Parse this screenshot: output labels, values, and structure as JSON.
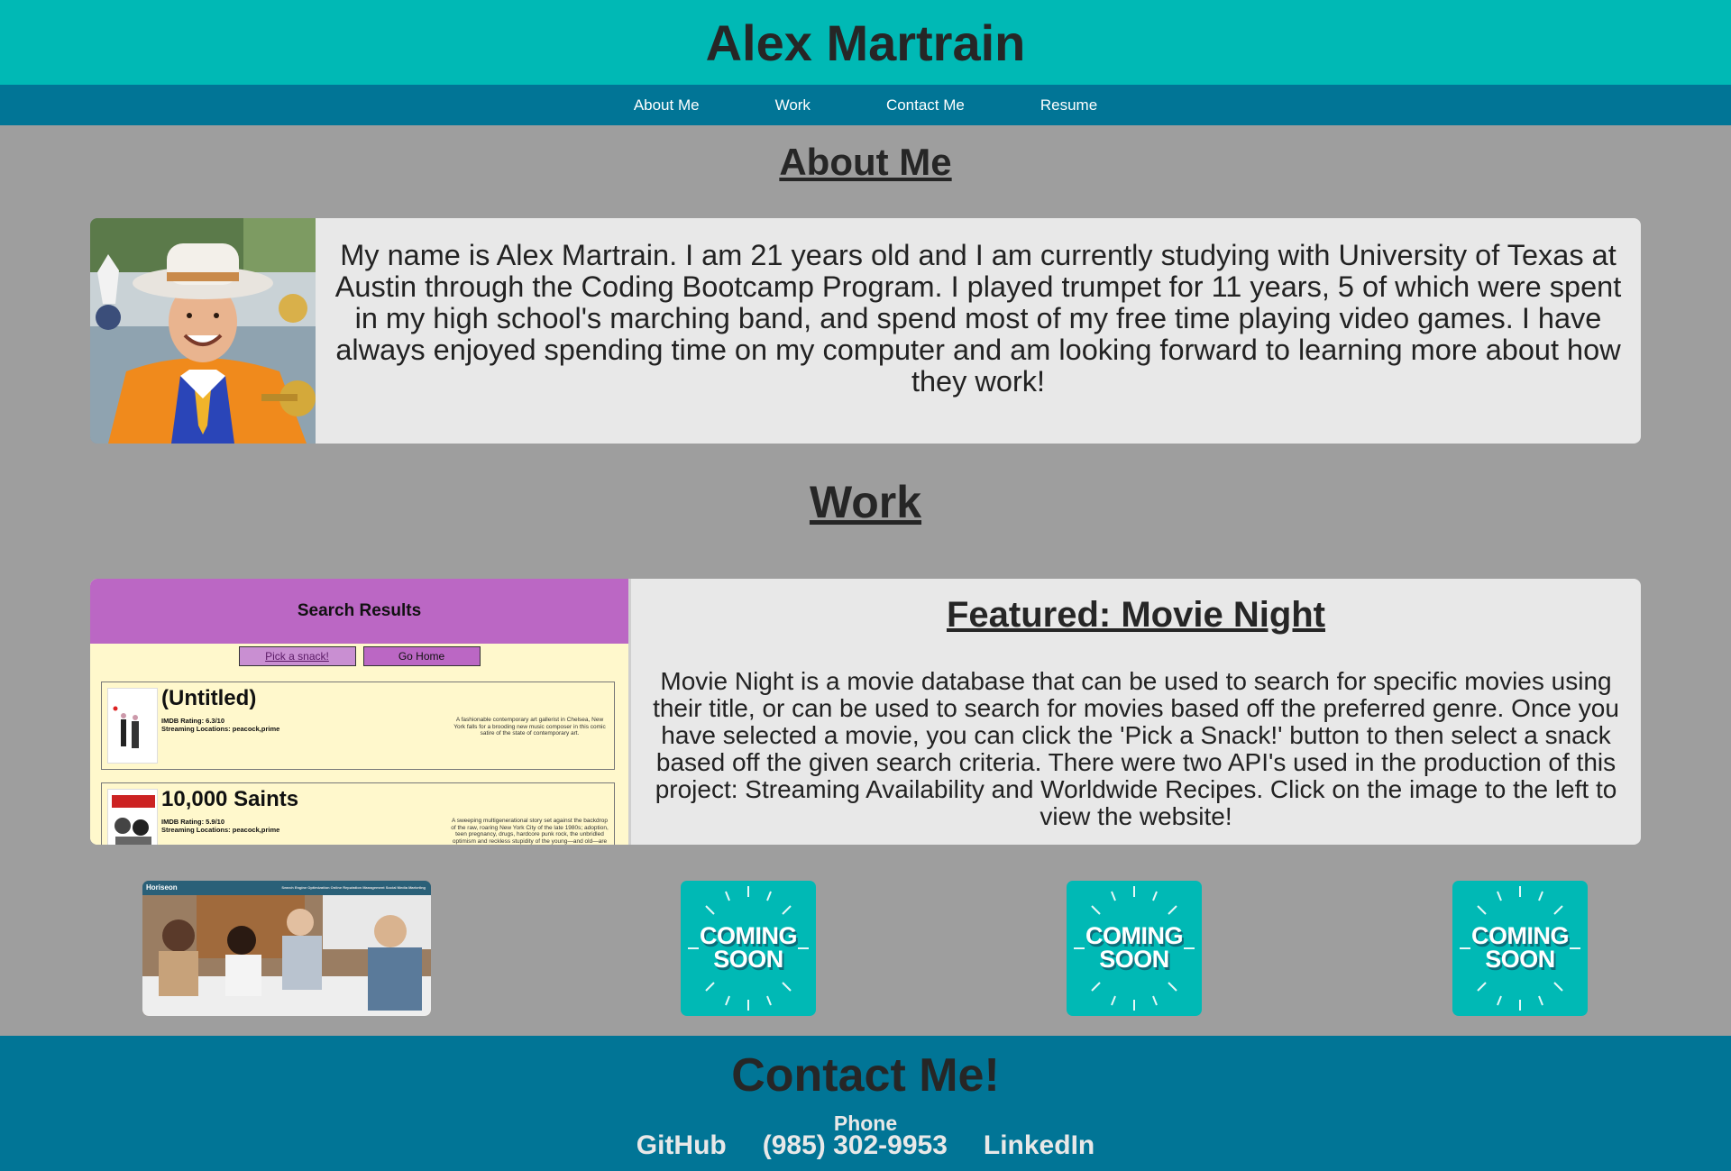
{
  "header": {
    "title": "Alex Martrain"
  },
  "nav": {
    "items": [
      {
        "label": "About Me"
      },
      {
        "label": "Work"
      },
      {
        "label": "Contact Me"
      },
      {
        "label": "Resume"
      }
    ]
  },
  "about": {
    "heading": "About Me",
    "bio": "My name is Alex Martrain. I am 21 years old and I am currently studying with University of Texas at Austin through the Coding Bootcamp Program. I played trumpet for 11 years, 5 of which were spent in my high school's marching band, and spend most of my free time playing video games. I have always enjoyed spending time on my computer and am looking forward to learning more about how they work!"
  },
  "work": {
    "heading": "Work",
    "featured_title": "Featured: Movie Night",
    "featured_description": "Movie Night is a movie database that can be used to search for specific movies using their title, or can be used to search for movies based off the preferred genre. Once you have selected a movie, you can click the 'Pick a Snack!' button to then select a snack based off the given search criteria. There were two API's used in the production of this project: Streaming Availability and Worldwide Recipes. Click on the image to the left to view the website!",
    "screenshot": {
      "header": "Search Results",
      "snack_button": "Pick a snack!",
      "home_button": "Go Home",
      "movies": [
        {
          "title": "(Untitled)",
          "rating": "IMDB Rating: 6.3/10",
          "streaming": "Streaming Locations: peacock,prime",
          "description": "A fashionable contemporary art gallerist in Chelsea, New York falls for a brooding new music composer in this comic satire of the state of contemporary art."
        },
        {
          "title": "10,000 Saints",
          "rating": "IMDB Rating: 5.9/10",
          "streaming": "Streaming Locations: peacock,prime",
          "description": "A sweeping multigenerational story set against the backdrop of the raw, roaring New York City of the late 1980s; adoption, teen pregnancy, drugs, hardcore punk rock, the unbridled optimism and reckless stupidity of the young—and old—are all major elements in this heart-aching tale of the son of diehard hippies and his strange odyssey through the extremes of late 20th"
        }
      ]
    },
    "thumbnails": {
      "horiseon_brand": "Horiseon",
      "horiseon_links": "Search Engine Optimization   Online Reputation Management   Social Media Marketing",
      "coming_soon_line1": "COMING",
      "coming_soon_line2": "SOON"
    }
  },
  "contact": {
    "heading": "Contact Me!",
    "phone_label": "Phone",
    "github": "GitHub",
    "phone": "(985) 302-9953",
    "linkedin": "LinkedIn"
  },
  "colors": {
    "header_bg": "#00b9b5",
    "nav_bg": "#017596",
    "page_bg": "#9e9e9e",
    "card_bg": "#e8e8e8",
    "shot_header": "#bb67c4",
    "shot_bg": "#fff8cc"
  }
}
